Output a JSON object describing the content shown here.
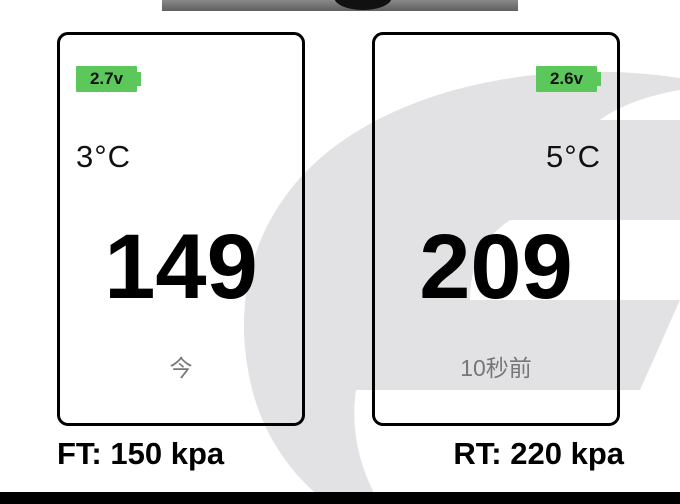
{
  "front": {
    "battery": "2.7v",
    "temperature": "3°C",
    "pressure": "149",
    "updated": "今",
    "summary": "FT: 150 kpa"
  },
  "rear": {
    "battery": "2.6v",
    "temperature": "5°C",
    "pressure": "209",
    "updated": "10秒前",
    "summary": "RT: 220 kpa"
  },
  "colors": {
    "battery": "#5cc75a",
    "watermark": "#e2e2e4",
    "updated_text": "#777777"
  }
}
